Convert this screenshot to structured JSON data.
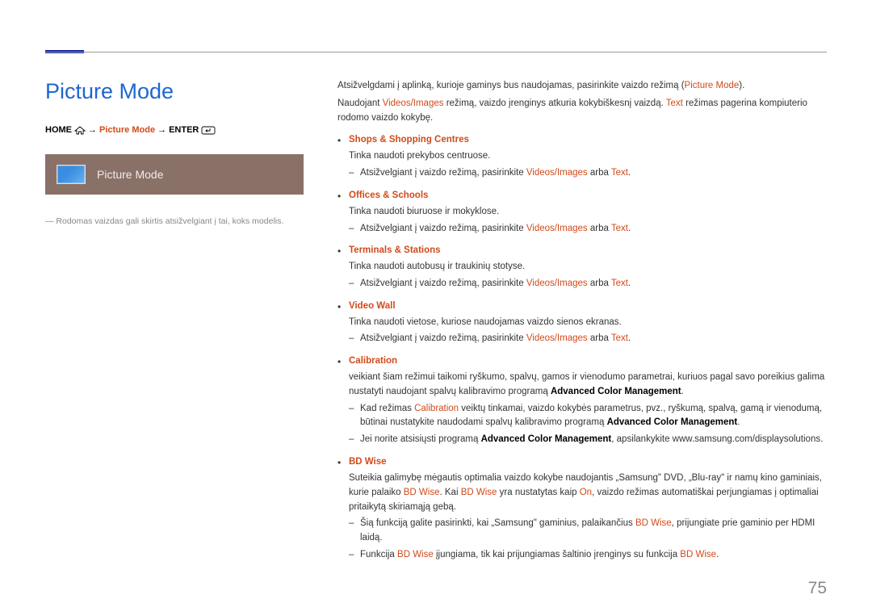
{
  "pageTitle": "Picture Mode",
  "pageNumber": "75",
  "breadcrumb": {
    "home": "HOME",
    "pm": "Picture Mode",
    "enter": "ENTER"
  },
  "pmBar": {
    "label": "Picture Mode"
  },
  "note": "―  Rodomas vaizdas gali skirtis atsižvelgiant į tai, koks modelis.",
  "intro": {
    "l1a": "Atsižvelgdami į aplinką, kurioje gaminys bus naudojamas, pasirinkite vaizdo režimą (",
    "l1b": "Picture Mode",
    "l1c": ").",
    "l2a": "Naudojant ",
    "l2b": "Videos/Images",
    "l2c": " režimą, vaizdo įrenginys atkuria kokybiškesnį vaizdą. ",
    "l2d": "Text",
    "l2e": " režimas pagerina kompiuterio rodomo vaizdo kokybę."
  },
  "items": {
    "shops": {
      "title": "Shops & Shopping Centres",
      "desc": "Tinka naudoti prekybos centruose.",
      "sub_a": "Atsižvelgiant į vaizdo režimą, pasirinkite ",
      "sub_b": "Videos/Images",
      "sub_c": " arba ",
      "sub_d": "Text",
      "sub_e": "."
    },
    "offices": {
      "title": "Offices & Schools",
      "desc": "Tinka naudoti biuruose ir mokyklose.",
      "sub_a": "Atsižvelgiant į vaizdo režimą, pasirinkite ",
      "sub_b": "Videos/Images",
      "sub_c": " arba ",
      "sub_d": "Text",
      "sub_e": "."
    },
    "terminals": {
      "title": "Terminals & Stations",
      "desc": "Tinka naudoti autobusų ir traukinių stotyse.",
      "sub_a": "Atsižvelgiant į vaizdo režimą, pasirinkite ",
      "sub_b": "Videos/Images",
      "sub_c": " arba ",
      "sub_d": "Text",
      "sub_e": "."
    },
    "videowall": {
      "title": "Video Wall",
      "desc": "Tinka naudoti vietose, kuriose naudojamas vaizdo sienos ekranas.",
      "sub_a": "Atsižvelgiant į vaizdo režimą, pasirinkite ",
      "sub_b": "Videos/Images",
      "sub_c": " arba ",
      "sub_d": "Text",
      "sub_e": "."
    },
    "calibration": {
      "title": "Calibration",
      "desc_a": "veikiant šiam režimui taikomi ryškumo, spalvų, gamos ir vienodumo parametrai, kuriuos pagal savo poreikius galima nustatyti naudojant spalvų kalibravimo programą ",
      "desc_b": "Advanced Color Management",
      "desc_c": ".",
      "s1a": "Kad režimas ",
      "s1b": "Calibration",
      "s1c": " veiktų tinkamai, vaizdo kokybės parametrus, pvz., ryškumą, spalvą, gamą ir vienodumą, būtinai nustatykite naudodami spalvų kalibravimo programą ",
      "s1d": "Advanced Color Management",
      "s1e": ".",
      "s2a": "Jei norite atsisiųsti programą ",
      "s2b": "Advanced Color Management",
      "s2c": ", apsilankykite www.samsung.com/displaysolutions."
    },
    "bdwise": {
      "title": "BD Wise",
      "desc_a": "Suteikia galimybę mėgautis optimalia vaizdo kokybe naudojantis „Samsung\" DVD, „Blu-ray\" ir namų kino gaminiais, kurie palaiko ",
      "desc_b": "BD Wise",
      "desc_c": ". Kai ",
      "desc_d": "BD Wise",
      "desc_e": " yra nustatytas kaip ",
      "desc_f": "On",
      "desc_g": ", vaizdo režimas automatiškai perjungiamas į optimaliai pritaikytą skiriamąją gebą.",
      "s1a": "Šią funkciją galite pasirinkti, kai „Samsung\" gaminius, palaikančius ",
      "s1b": "BD Wise",
      "s1c": ", prijungiate prie gaminio per HDMI laidą.",
      "s2a": "Funkcija ",
      "s2b": "BD Wise",
      "s2c": " įjungiama, tik kai prijungiamas šaltinio įrenginys su funkcija ",
      "s2d": "BD Wise",
      "s2e": "."
    }
  }
}
